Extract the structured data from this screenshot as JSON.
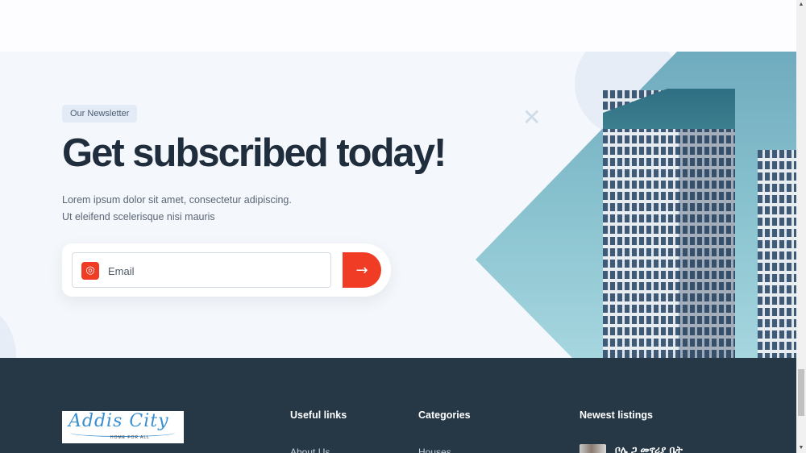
{
  "newsletter": {
    "badge": "Our Newsletter",
    "headline": "Get subscribed today!",
    "description": "Lorem ipsum dolor sit amet, consectetur adipiscing. Ut eleifend scelerisque nisi mauris",
    "email_placeholder": "Email",
    "email_value": "",
    "icon_field": "fingerprint-icon",
    "icon_submit": "arrow-right-icon",
    "accent_color": "#f03b25"
  },
  "footer": {
    "logo_text": "Addis City",
    "logo_tagline": "HOME FOR ALL",
    "columns": [
      {
        "heading": "Useful links",
        "first_link": "About Us"
      },
      {
        "heading": "Categories",
        "first_link": "Houses"
      },
      {
        "heading": "Newest listings",
        "first_listing": "ቦሌ ጋ መኖሪያ ቤት"
      }
    ],
    "background_color": "#263846"
  }
}
